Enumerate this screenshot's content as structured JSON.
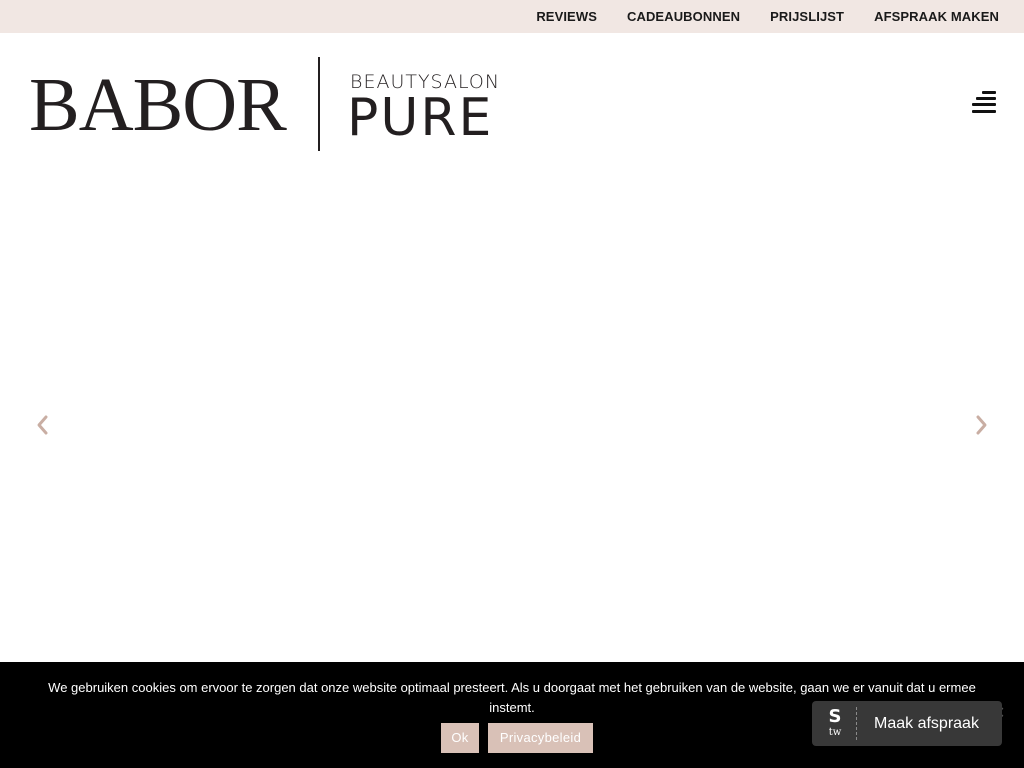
{
  "topnav": {
    "items": [
      {
        "label": "REVIEWS"
      },
      {
        "label": "CADEAUBONNEN"
      },
      {
        "label": "PRIJSLIJST"
      },
      {
        "label": "AFSPRAAK MAKEN"
      }
    ]
  },
  "logo": {
    "brand": "BABOR",
    "subtitle": "BEAUTYSALON",
    "name": "PURE"
  },
  "header": {
    "menu_icon": "hamburger-menu-icon"
  },
  "slider": {
    "prev_icon": "chevron-left-icon",
    "next_icon": "chevron-right-icon"
  },
  "cookie": {
    "text": "We gebruiken cookies om ervoor te zorgen dat onze website optimaal presteert. Als u doorgaat met het gebruiken van de website, gaan we er vanuit dat u ermee instemt.",
    "ok_label": "Ok",
    "privacy_label": "Privacybeleid",
    "close_icon": "close-icon"
  },
  "booking_widget": {
    "logo_s": "S",
    "logo_tw": "tw",
    "label": "Maak afspraak"
  },
  "colors": {
    "topbar_bg": "#f1e7e3",
    "cookie_button_bg": "#d9c1b7",
    "cookie_bar_bg": "#000000",
    "widget_bg": "#383838",
    "arrow_color": "#c9aea3"
  }
}
